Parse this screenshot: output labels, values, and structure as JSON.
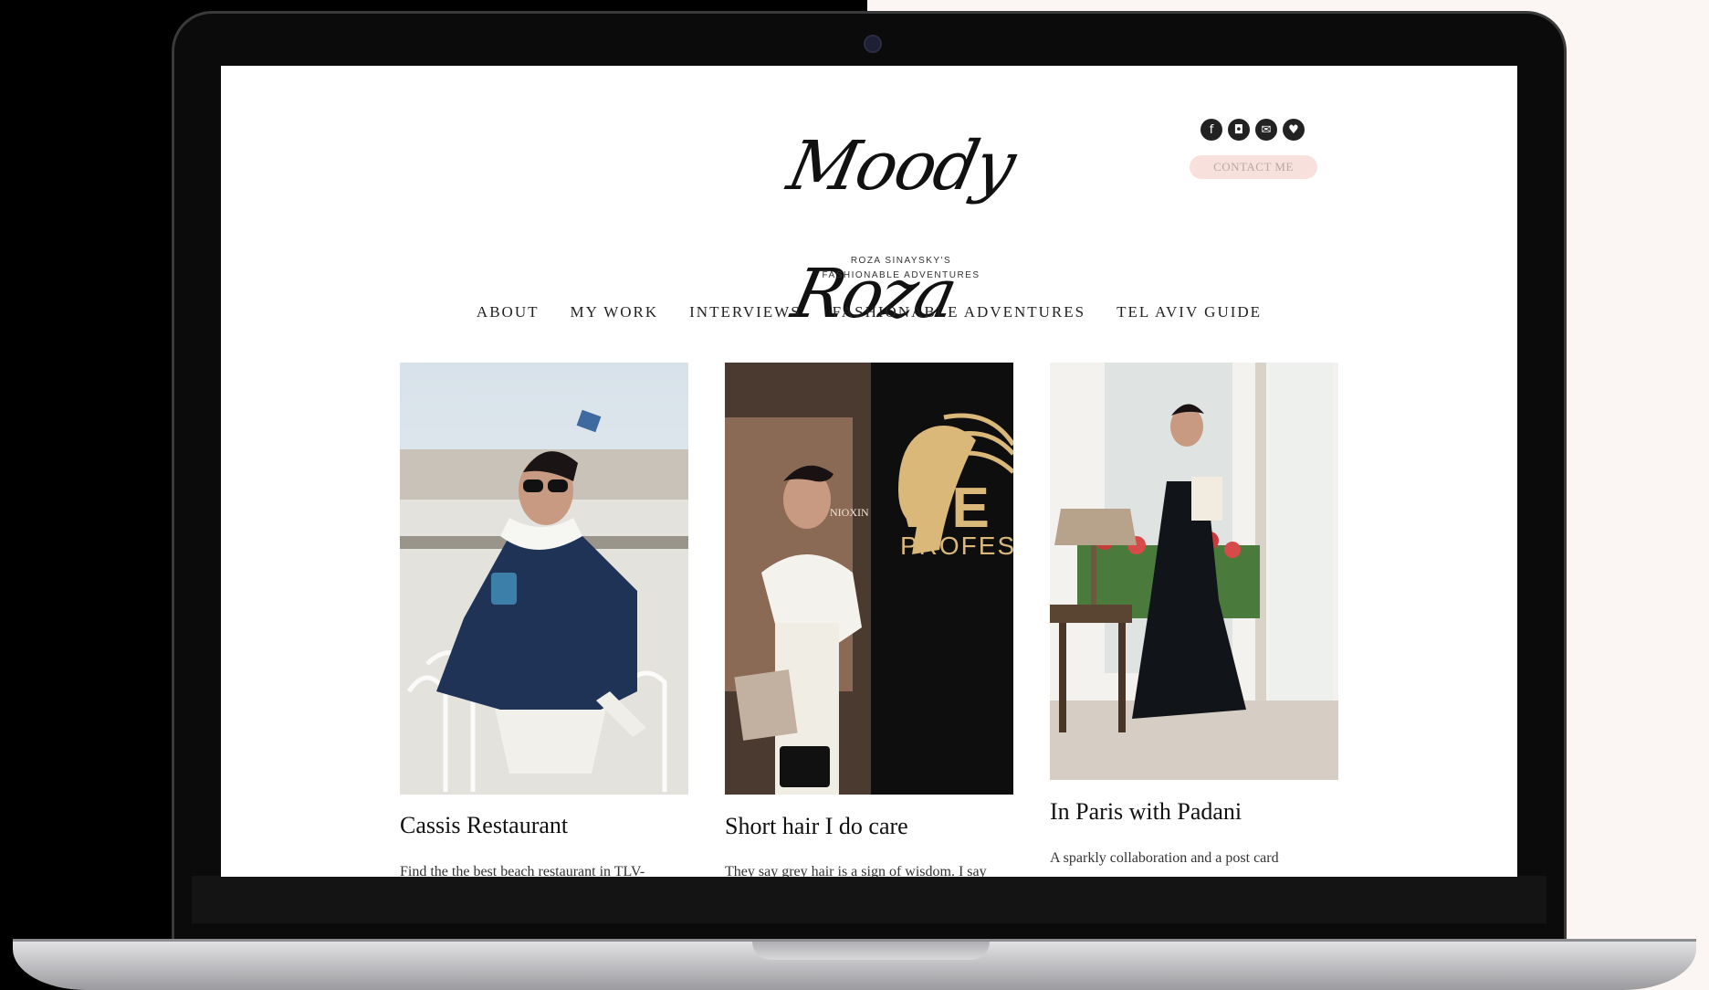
{
  "site": {
    "logo_script": "Moody Roza",
    "logo_sub_line1": "ROZA SINAYSKY'S",
    "logo_sub_line2": "FASHIONABLE ADVENTURES",
    "contact_label": "CONTACT ME",
    "social_icons": [
      "facebook-icon",
      "instagram-icon",
      "email-icon",
      "bloglovin-icon"
    ]
  },
  "nav": {
    "items": [
      {
        "label": "ABOUT"
      },
      {
        "label": "MY WORK"
      },
      {
        "label": "INTERVIEWS"
      },
      {
        "label": "FASHIONABLE ADVENTURES"
      },
      {
        "label": "TEL AVIV GUIDE"
      }
    ]
  },
  "posts": [
    {
      "title": "Cassis Restaurant",
      "excerpt": "Find the the best beach restaurant in TLV-"
    },
    {
      "title": "Short hair I do care",
      "excerpt": "They say grey hair is a sign of wisdom. I say",
      "sign_text": "WE",
      "sign_text2": "PROFES",
      "sign_small": "NIOXIN"
    },
    {
      "title": "In Paris with Padani",
      "excerpt": "A sparkly collaboration and a post card"
    }
  ],
  "colors": {
    "contact_bg": "#f8e1dd",
    "background_right": "#fbf6f3"
  }
}
